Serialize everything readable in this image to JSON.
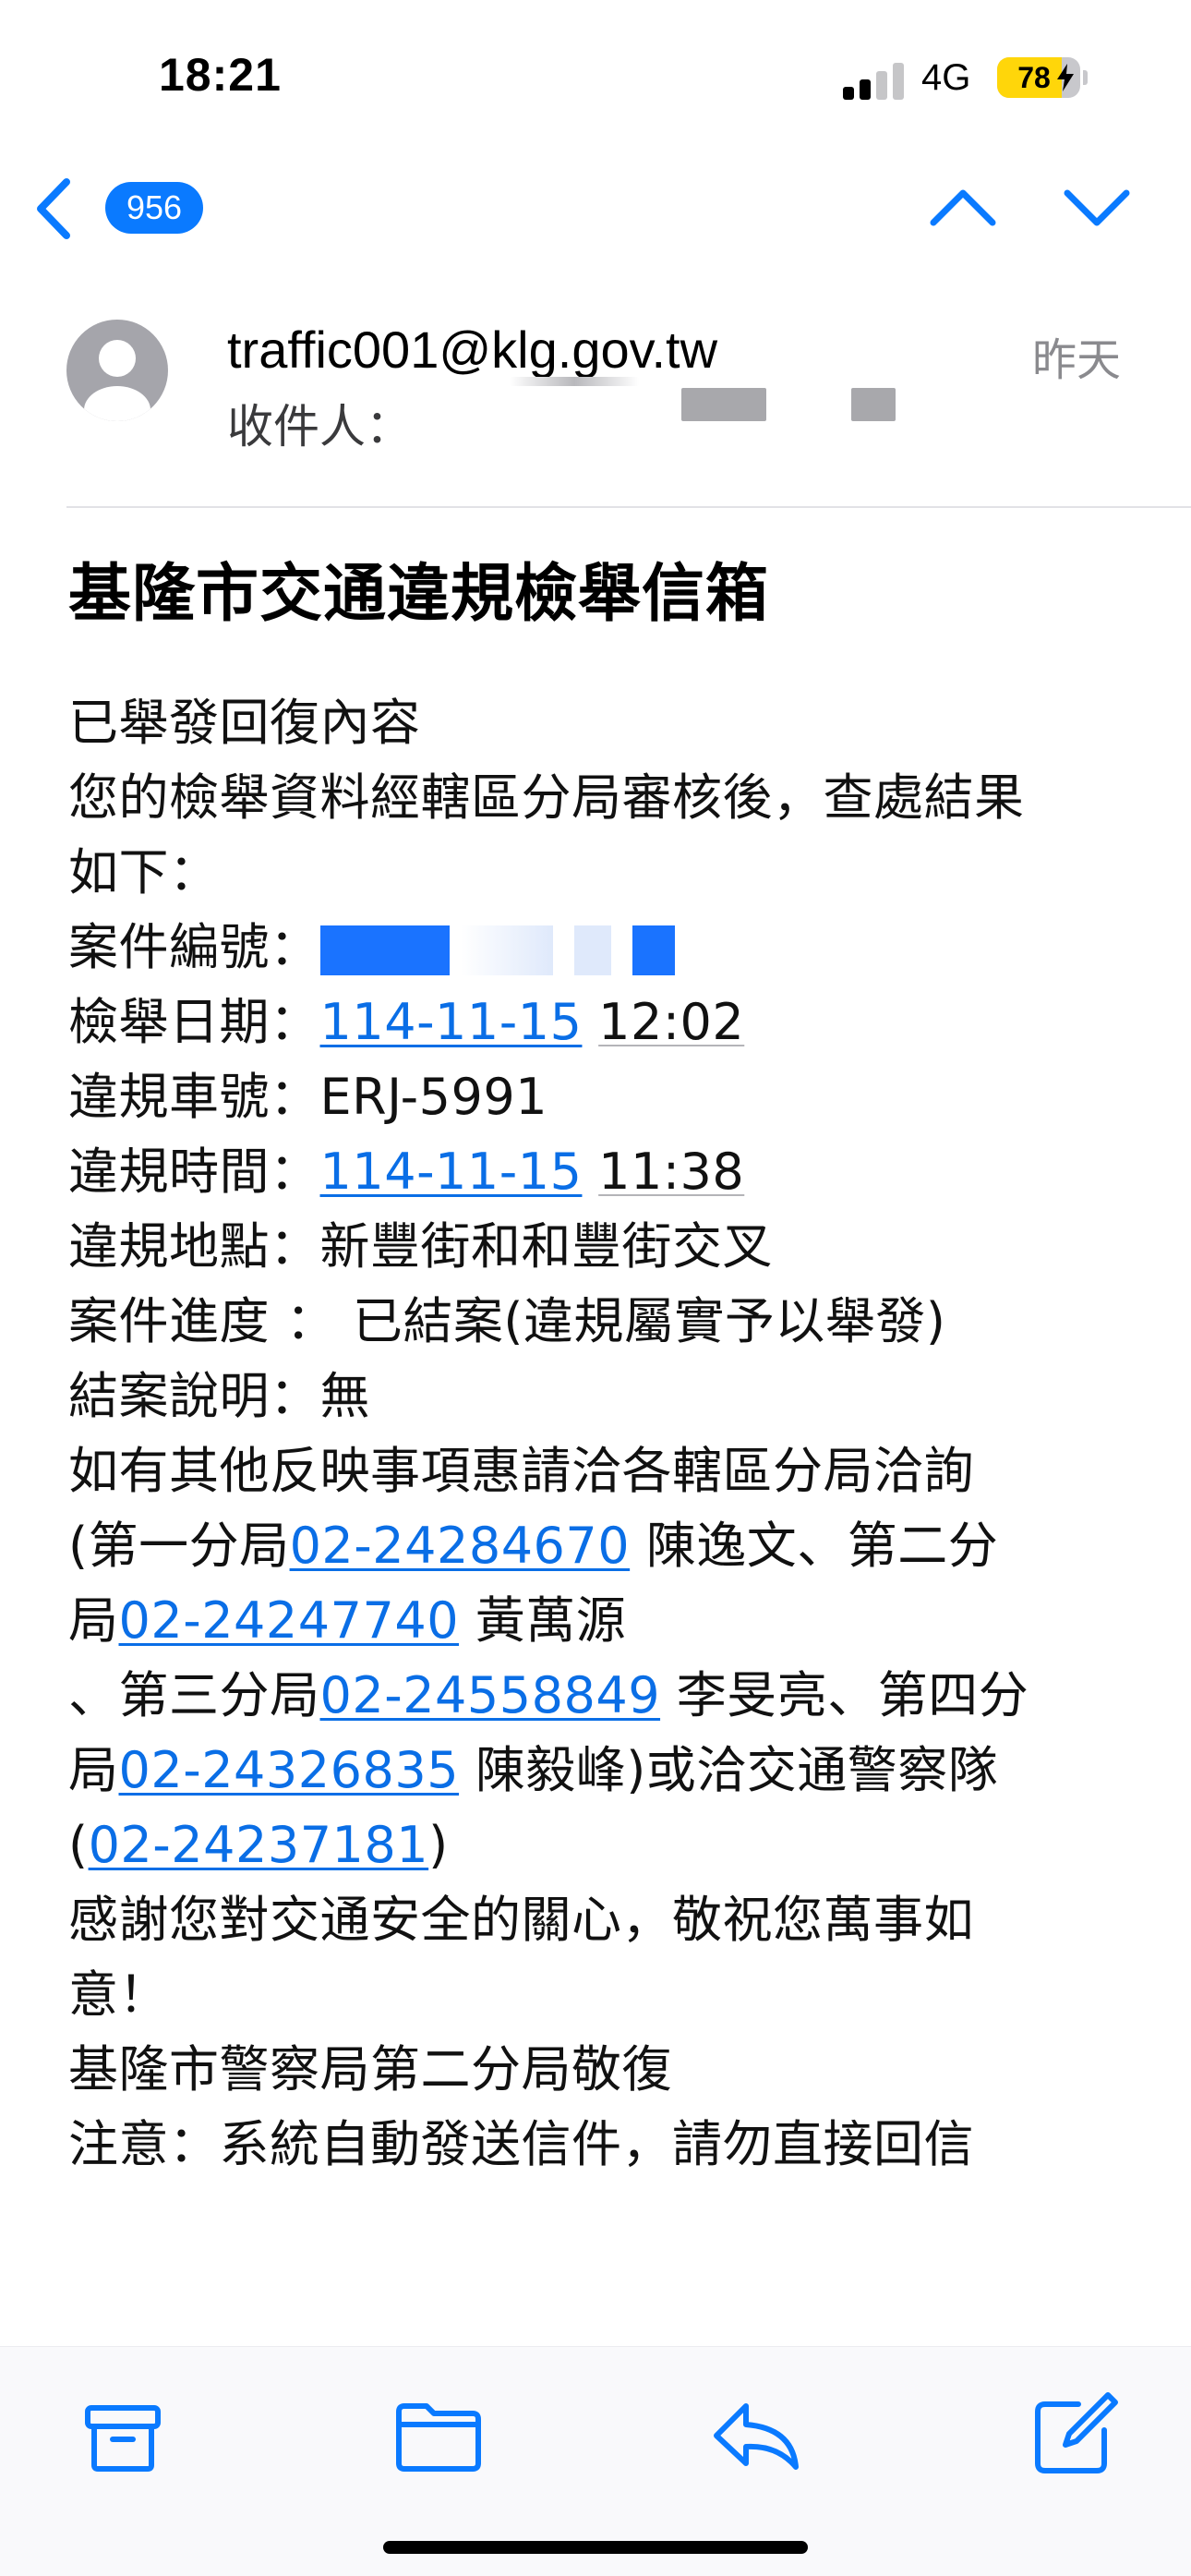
{
  "status_bar": {
    "time": "18:21",
    "network": "4G",
    "battery_level": 78,
    "battery_text": "78",
    "signal_bars_active": 2,
    "signal_bars_total": 4
  },
  "nav": {
    "unread_count": "956",
    "accent_color": "#0a7aff"
  },
  "header": {
    "sender": "traffic001@klg.gov.tw",
    "date": "昨天",
    "recipient_label": "收件人："
  },
  "message": {
    "subject": "基隆市交通違規檢舉信箱",
    "line_1": "已舉發回復內容",
    "line_2": "您的檢舉資料經轄區分局審核後，查處結果",
    "line_3": "如下：",
    "case_number_label": "案件編號：",
    "report_date_label": "檢舉日期：",
    "report_date": "114-11-15",
    "report_time": "12:02",
    "plate_label": "違規車號：",
    "plate": "ERJ-5991",
    "violation_time_label": "違規時間：",
    "violation_date": "114-11-15",
    "violation_time": "11:38",
    "location_label": "違規地點：",
    "location": "新豐街和和豐街交叉",
    "progress_label": "案件進度 ： ",
    "progress": "已結案(違規屬實予以舉發)",
    "closing_label": "結案說明：",
    "closing": "無",
    "inquiry_line": "如有其他反映事項惠請洽各轄區分局洽詢",
    "inquiry_1_prefix": "(第一分局",
    "phone_1": "02-24284670",
    "inquiry_1_suffix": " 陳逸文、第二分",
    "inquiry_2_prefix": "局",
    "phone_2": "02-24247740",
    "inquiry_2_suffix": " 黃萬源",
    "inquiry_3_prefix": "、第三分局",
    "phone_3": "02-24558849",
    "inquiry_3_suffix": " 李旻亮、第四分",
    "inquiry_4_prefix": "局",
    "phone_4": "02-24326835",
    "inquiry_4_suffix": " 陳毅峰)或洽交通警察隊",
    "inquiry_5_prefix": "(",
    "phone_5": "02-24237181",
    "inquiry_5_suffix": ")",
    "thanks_1": "感謝您對交通安全的關心，敬祝您萬事如",
    "thanks_2": "意！",
    "signature": "基隆市警察局第二分局敬復",
    "notice": "注意：系統自動發送信件，請勿直接回信"
  },
  "toolbar": {
    "archive_icon": "archive-box-icon",
    "move_icon": "folder-icon",
    "reply_icon": "reply-arrow-icon",
    "compose_icon": "compose-icon"
  }
}
